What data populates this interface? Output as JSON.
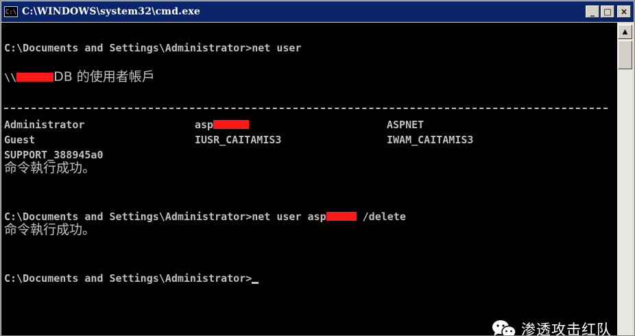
{
  "window": {
    "icon_label": "C:\\",
    "title": "C:\\WINDOWS\\system32\\cmd.exe",
    "buttons": {
      "minimize": "_",
      "maximize": "□",
      "close": "×"
    }
  },
  "console": {
    "line1_prompt": "C:\\Documents and Settings\\Administrator>",
    "line1_cmd": "net user",
    "accounts_prefix": "\\\\",
    "accounts_suffix": "DB 的使用者帳戶",
    "users": {
      "r1c1": "Administrator",
      "r1c2_prefix": "asp",
      "r1c3": "ASPNET",
      "r2c1": "Guest",
      "r2c2": "IUSR_CAITAMIS3",
      "r2c3": "IWAM_CAITAMIS3",
      "r3c1": "SUPPORT_388945a0"
    },
    "success1": "命令執行成功。",
    "line2_prompt": "C:\\Documents and Settings\\Administrator>",
    "line2_cmd_prefix": "net user asp",
    "line2_cmd_suffix": " /delete",
    "success2": "命令執行成功。",
    "line3_prompt": "C:\\Documents and Settings\\Administrator>"
  },
  "scrollbar": {
    "up_arrow": "▲"
  },
  "watermark": {
    "text": "渗透攻击红队"
  },
  "colors": {
    "console_bg": "#000000",
    "console_text": "#c0c0c0",
    "titlebar": "#0a246a",
    "redaction": "#ff1a1a"
  }
}
